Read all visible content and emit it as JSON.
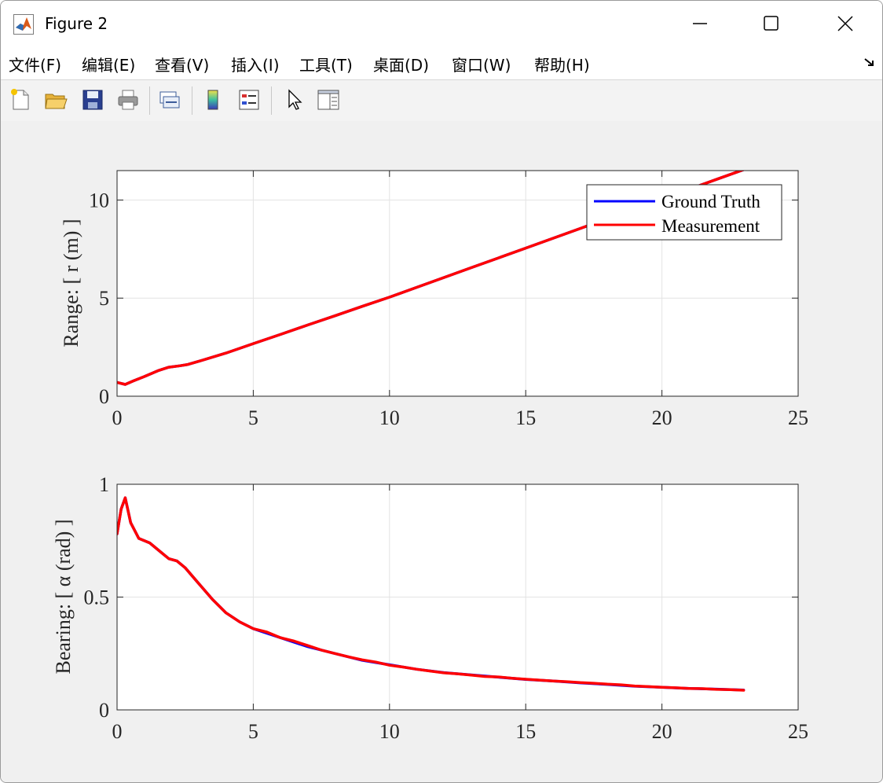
{
  "window": {
    "title": "Figure 2",
    "controls": {
      "minimize": "—",
      "maximize": "□",
      "close": "✕"
    }
  },
  "menu": {
    "items": [
      "文件(F)",
      "编辑(E)",
      "查看(V)",
      "插入(I)",
      "工具(T)",
      "桌面(D)",
      "窗口(W)",
      "帮助(H)"
    ],
    "overflow_icon": "dock-arrow-icon"
  },
  "toolbar": {
    "tools": [
      {
        "name": "new-figure-icon"
      },
      {
        "name": "open-file-icon"
      },
      {
        "name": "save-icon"
      },
      {
        "name": "print-icon"
      },
      {
        "name": "link-plot-icon"
      },
      {
        "name": "colorbar-icon"
      },
      {
        "name": "legend-icon"
      },
      {
        "name": "pointer-icon"
      },
      {
        "name": "property-inspector-icon"
      }
    ]
  },
  "colors": {
    "ground_truth": "#0000ff",
    "measurement": "#ff0000",
    "grid": "#e3e3e3",
    "axes_bg": "#ffffff"
  },
  "chart_data": [
    {
      "type": "line",
      "title": "",
      "xlabel": "",
      "ylabel": "Range: [ r (m) ]",
      "xlim": [
        0,
        25
      ],
      "ylim": [
        0,
        11.5
      ],
      "xticks": [
        0,
        5,
        10,
        15,
        20,
        25
      ],
      "yticks": [
        0,
        5,
        10
      ],
      "xtick_labels": [
        "0",
        "5",
        "10",
        "15",
        "20",
        "25"
      ],
      "ytick_labels": [
        "0",
        "5",
        "10"
      ],
      "grid": true,
      "legend": {
        "position": "top-right",
        "entries": [
          "Ground Truth",
          "Measurement"
        ]
      },
      "series": [
        {
          "name": "Ground Truth",
          "color": "#0000ff",
          "x": [
            0,
            0.3,
            0.6,
            1.0,
            1.5,
            1.9,
            2.3,
            2.6,
            3.0,
            4.0,
            5.0,
            6.0,
            7.0,
            8.0,
            9.0,
            10.0,
            11.0,
            12.0,
            13.0,
            14.0,
            15.0,
            16.0,
            17.0,
            18.0,
            19.0,
            20.0,
            21.0,
            22.0,
            23.0
          ],
          "y": [
            0.7,
            0.6,
            0.78,
            1.0,
            1.3,
            1.48,
            1.55,
            1.62,
            1.78,
            2.2,
            2.68,
            3.15,
            3.63,
            4.1,
            4.58,
            5.05,
            5.55,
            6.05,
            6.55,
            7.05,
            7.55,
            8.05,
            8.55,
            9.05,
            9.55,
            10.05,
            10.55,
            11.05,
            11.55
          ]
        },
        {
          "name": "Measurement",
          "color": "#ff0000",
          "x": [
            0,
            0.3,
            0.6,
            1.0,
            1.5,
            1.9,
            2.3,
            2.6,
            3.0,
            4.0,
            5.0,
            6.0,
            7.0,
            8.0,
            9.0,
            10.0,
            11.0,
            12.0,
            13.0,
            14.0,
            15.0,
            16.0,
            17.0,
            18.0,
            19.0,
            20.0,
            21.0,
            22.0,
            23.0
          ],
          "y": [
            0.7,
            0.6,
            0.78,
            1.0,
            1.3,
            1.48,
            1.55,
            1.62,
            1.78,
            2.2,
            2.68,
            3.15,
            3.63,
            4.1,
            4.58,
            5.05,
            5.55,
            6.05,
            6.55,
            7.05,
            7.55,
            8.05,
            8.55,
            9.05,
            9.55,
            10.05,
            10.55,
            11.05,
            11.55
          ]
        }
      ]
    },
    {
      "type": "line",
      "title": "",
      "xlabel": "",
      "ylabel": "Bearing: [ α (rad) ]",
      "xlim": [
        0,
        25
      ],
      "ylim": [
        0,
        1
      ],
      "xticks": [
        0,
        5,
        10,
        15,
        20,
        25
      ],
      "yticks": [
        0,
        0.5,
        1
      ],
      "xtick_labels": [
        "0",
        "5",
        "10",
        "15",
        "20",
        "25"
      ],
      "ytick_labels": [
        "0",
        "0.5",
        "1"
      ],
      "grid": true,
      "series": [
        {
          "name": "Ground Truth",
          "color": "#0000ff",
          "x": [
            0,
            0.15,
            0.3,
            0.5,
            0.8,
            1.2,
            1.6,
            1.9,
            2.2,
            2.5,
            3.0,
            3.5,
            4.0,
            4.5,
            5.0,
            6.0,
            7.0,
            8.0,
            9.0,
            10.0,
            11.0,
            12.0,
            13.0,
            14.0,
            15.0,
            16.0,
            17.0,
            18.0,
            19.0,
            20.0,
            21.0,
            22.0,
            23.0
          ],
          "y": [
            0.78,
            0.89,
            0.94,
            0.83,
            0.76,
            0.74,
            0.7,
            0.67,
            0.66,
            0.63,
            0.56,
            0.49,
            0.43,
            0.39,
            0.36,
            0.32,
            0.28,
            0.25,
            0.22,
            0.2,
            0.18,
            0.165,
            0.155,
            0.145,
            0.135,
            0.128,
            0.12,
            0.113,
            0.105,
            0.1,
            0.095,
            0.092,
            0.088
          ]
        },
        {
          "name": "Measurement",
          "color": "#ff0000",
          "x": [
            0,
            0.15,
            0.3,
            0.5,
            0.8,
            1.2,
            1.6,
            1.9,
            2.2,
            2.5,
            3.0,
            3.5,
            4.0,
            4.5,
            5.0,
            5.5,
            6.0,
            6.5,
            7.0,
            7.5,
            8.0,
            8.5,
            9.0,
            9.5,
            10.0,
            10.5,
            11.0,
            11.5,
            12.0,
            12.5,
            13.0,
            13.5,
            14.0,
            14.5,
            15.0,
            15.5,
            16.0,
            16.5,
            17.0,
            17.5,
            18.0,
            18.5,
            19.0,
            19.5,
            20.0,
            20.5,
            21.0,
            21.5,
            22.0,
            22.5,
            23.0
          ],
          "y": [
            0.78,
            0.89,
            0.94,
            0.83,
            0.76,
            0.74,
            0.7,
            0.67,
            0.66,
            0.63,
            0.56,
            0.49,
            0.43,
            0.39,
            0.36,
            0.345,
            0.32,
            0.305,
            0.285,
            0.265,
            0.25,
            0.235,
            0.222,
            0.212,
            0.198,
            0.19,
            0.18,
            0.172,
            0.164,
            0.16,
            0.154,
            0.148,
            0.146,
            0.14,
            0.136,
            0.132,
            0.128,
            0.125,
            0.121,
            0.118,
            0.114,
            0.111,
            0.106,
            0.103,
            0.1,
            0.098,
            0.095,
            0.094,
            0.091,
            0.09,
            0.087
          ]
        }
      ]
    }
  ]
}
